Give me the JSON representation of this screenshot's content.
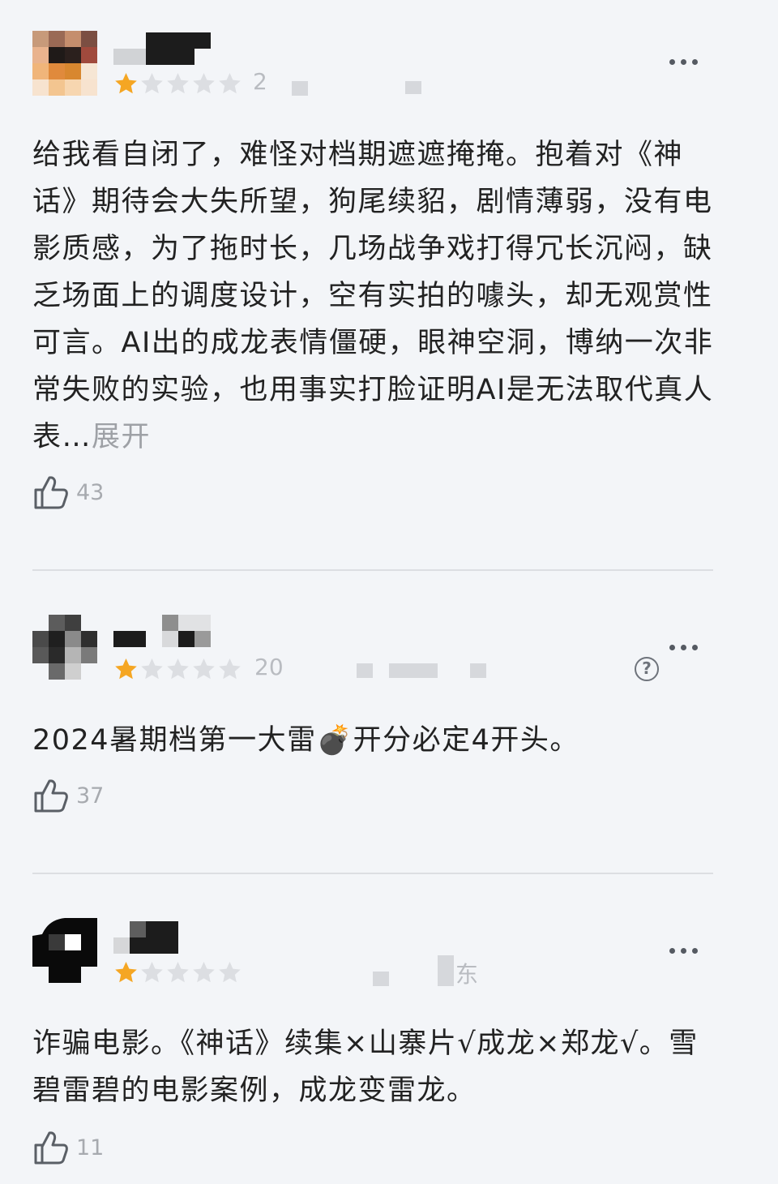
{
  "reviews": [
    {
      "rating": 1,
      "meta": "2",
      "meta_extra": "",
      "text": "给我看自闭了，难怪对档期遮遮掩掩。抱着对《神话》期待会大失所望，狗尾续貂，剧情薄弱，没有电影质感，为了拖时长，几场战争戏打得冗长沉闷，缺乏场面上的调度设计，空有实拍的噱头，却无观赏性可言。AI出的成龙表情僵硬，眼神空洞，博纳一次非常失败的实验，也用事实打脸证明AI是无法取代真人表…",
      "expand": "展开",
      "likes": "43"
    },
    {
      "rating": 1,
      "meta": "20",
      "meta_extra": "",
      "text": "2024暑期档第一大雷💣开分必定4开头。",
      "expand": "",
      "likes": "37",
      "help": "?"
    },
    {
      "rating": 1,
      "meta": "",
      "meta_extra": "东",
      "text": "诈骗电影。《神话》续集×山寨片√成龙×郑龙√。雪碧雷碧的电影案例，成龙变雷龙。",
      "expand": "",
      "likes": "11"
    }
  ],
  "colors": {
    "star_filled": "#f5a623",
    "star_empty": "#dcdee2",
    "background": "#f3f5f8"
  },
  "icons": [
    "thumbs-up-icon",
    "more-icon",
    "help-icon",
    "star-icon"
  ]
}
